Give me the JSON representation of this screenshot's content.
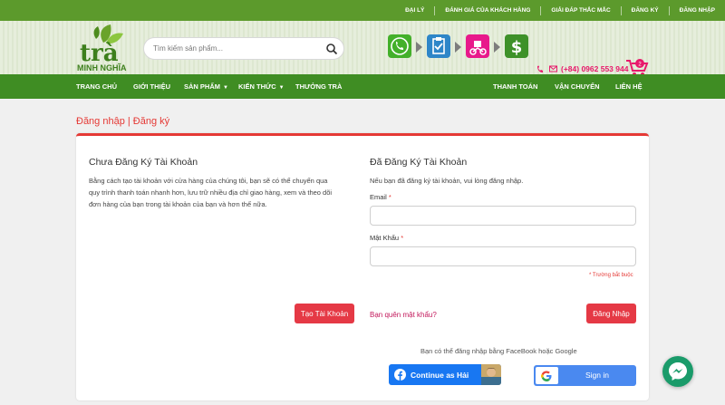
{
  "topbar": {
    "links": [
      "ĐẠI LÝ",
      "ĐÁNH GIÁ CỦA KHÁCH HÀNG",
      "GIẢI ĐÁP THẮC MẮC",
      "ĐĂNG KÝ",
      "ĐĂNG NHẬP"
    ]
  },
  "header": {
    "logo_top": "trà",
    "logo_bottom": "MINH NGHĨA",
    "search_placeholder": "Tìm kiếm sản phẩm...",
    "phone": "(+84) 0962 553 944",
    "cart_count": "2"
  },
  "nav": {
    "home": "TRANG CHỦ",
    "about": "GIỚI THIỆU",
    "products": "SẢN PHẨM",
    "knowledge": "KIẾN THỨC",
    "tea": "THƯỞNG TRÀ",
    "payment": "THANH TOÁN",
    "shipping": "VẬN CHUYỂN",
    "contact": "LIÊN HỆ"
  },
  "breadcrumb": "Đăng nhập | Đăng ký",
  "register": {
    "title": "Chưa Đăng Ký Tài Khoản",
    "desc_lines": [
      "Bằng cách tạo tài khoản với cửa hàng của chúng tôi, bạn sẽ có thể chuyển qua",
      "quy trình thanh toán nhanh hơn, lưu trữ nhiều địa chỉ giao hàng, xem và theo dõi",
      "đơn hàng của bạn trong tài khoản của bạn và hơn thế nữa."
    ],
    "button": "Tạo Tài Khoản"
  },
  "login": {
    "title": "Đã Đăng Ký Tài Khoản",
    "desc": "Nếu bạn đã đăng ký tài khoản, vui lòng đăng nhập.",
    "email_label": "Email",
    "password_label": "Mật Khẩu",
    "required_mark": "*",
    "required_note": "* Trường bắt buộc",
    "forgot": "Bạn quên mật khẩu?",
    "button": "Đăng Nhập"
  },
  "social": {
    "note": "Bạn có thể đăng nhập bằng FaceBook hoặc Google",
    "facebook": "Continue as Hải",
    "google": "Sign in"
  }
}
